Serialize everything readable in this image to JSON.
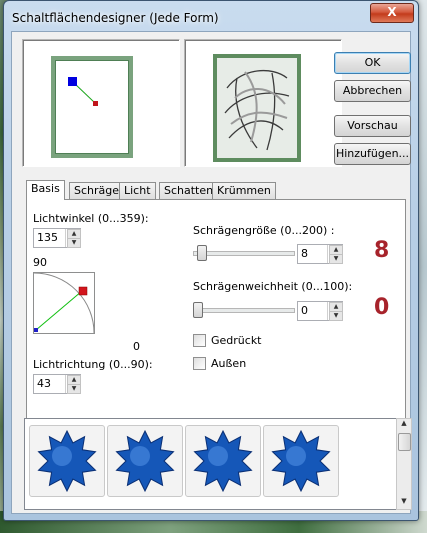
{
  "window": {
    "title": "Schaltflächendesigner (Jede Form)",
    "close_label": "X"
  },
  "buttons": {
    "ok": "OK",
    "cancel": "Abbrechen",
    "preview": "Vorschau",
    "add": "Hinzufügen..."
  },
  "tabs": [
    {
      "label": "Basis",
      "active": true
    },
    {
      "label": "Schräge",
      "active": false
    },
    {
      "label": "Licht",
      "active": false
    },
    {
      "label": "Schatten",
      "active": false
    },
    {
      "label": "Krümmen",
      "active": false
    }
  ],
  "basis": {
    "light_angle_label": "Lichtwinkel (0...359):",
    "light_angle_value": "135",
    "dial_top_label": "90",
    "dial_right_label": "0",
    "light_direction_label": "Lichtrichtung (0...90):",
    "light_direction_value": "43",
    "bevel_size_label": "Schrägengröße (0...200) :",
    "bevel_size_value": "8",
    "bevel_size_fraction": 0.04,
    "bevel_size_big": "8",
    "bevel_softness_label": "Schrägenweichheit (0...100):",
    "bevel_softness_value": "0",
    "bevel_softness_fraction": 0.0,
    "bevel_softness_big": "0",
    "pressed_label": "Gedrückt",
    "outside_label": "Außen"
  },
  "colors": {
    "accent_red": "#a7232b",
    "frame_green": "#7aa37e",
    "star_blue": "#1557b8"
  },
  "gallery": {
    "items": [
      "star-shape",
      "star-shape",
      "star-shape",
      "star-shape"
    ]
  }
}
